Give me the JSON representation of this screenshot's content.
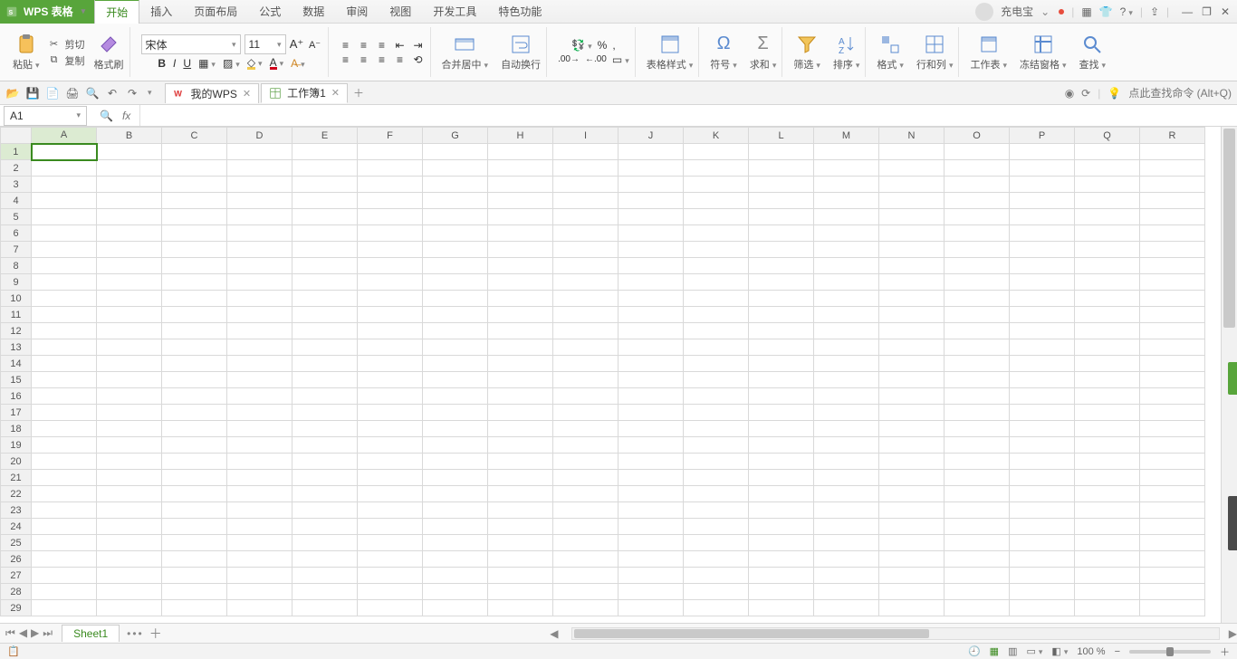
{
  "app": {
    "name": "WPS 表格"
  },
  "user": {
    "name": "充电宝"
  },
  "menu": {
    "tabs": [
      "开始",
      "插入",
      "页面布局",
      "公式",
      "数据",
      "审阅",
      "视图",
      "开发工具",
      "特色功能"
    ],
    "active": 0
  },
  "clipboard": {
    "paste": "粘贴",
    "cut": "剪切",
    "copy": "复制",
    "format_painter": "格式刷"
  },
  "font": {
    "name": "宋体",
    "size": "11"
  },
  "ribbon": {
    "merge_center": "合并居中",
    "wrap_text": "自动换行",
    "table_style": "表格样式",
    "symbol": "符号",
    "sum": "求和",
    "filter": "筛选",
    "sort": "排序",
    "format": "格式",
    "rows_cols": "行和列",
    "worksheet": "工作表",
    "freeze": "冻结窗格",
    "find": "查找"
  },
  "qat_tabs": {
    "mywps": "我的WPS",
    "workbook": "工作簿1"
  },
  "search_hint": "点此查找命令 (Alt+Q)",
  "name_box": "A1",
  "columns": [
    "A",
    "B",
    "C",
    "D",
    "E",
    "F",
    "G",
    "H",
    "I",
    "J",
    "K",
    "L",
    "M",
    "N",
    "O",
    "P",
    "Q",
    "R"
  ],
  "row_count": 29,
  "selected": {
    "row": 1,
    "col": 0
  },
  "sheet": {
    "name": "Sheet1"
  },
  "status": {
    "zoom": "100 %"
  }
}
